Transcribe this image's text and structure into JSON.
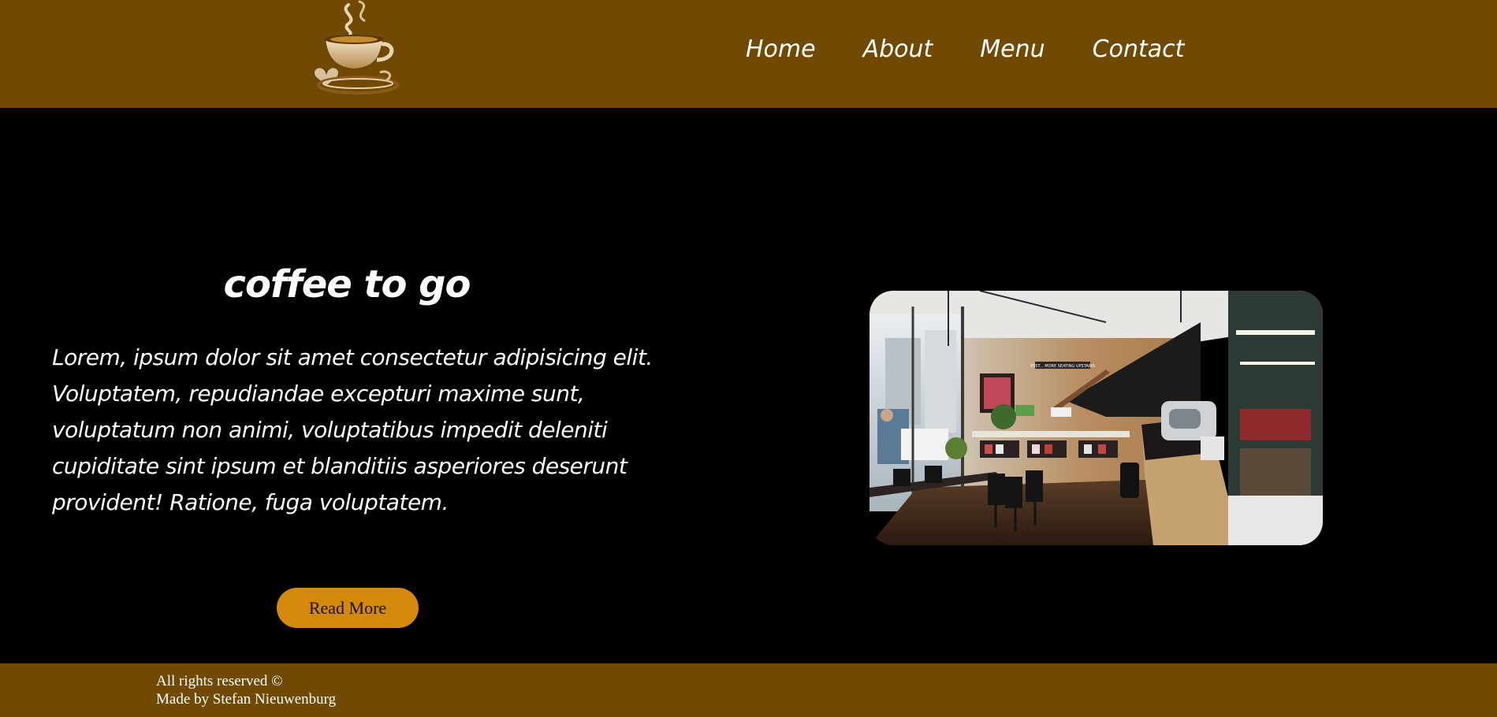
{
  "colors": {
    "header_bg": "#704903",
    "main_bg": "#000000",
    "footer_bg": "#704903",
    "button_bg": "#d4890a",
    "text": "#ffffff"
  },
  "header": {
    "logo_icon": "coffee-cup-icon",
    "nav": [
      {
        "label": "Home"
      },
      {
        "label": "About"
      },
      {
        "label": "Menu"
      },
      {
        "label": "Contact"
      }
    ]
  },
  "hero": {
    "title": "coffee to go",
    "text": "Lorem, ipsum dolor sit amet consectetur adipisicing elit. Voluptatem, repudiandae excepturi maxime sunt, voluptatum non animi, voluptatibus impedit deleniti cupiditate sint ipsum et blanditiis asperiores deserunt provident! Ratione, fuga voluptatem.",
    "button_label": "Read More",
    "photo_sign": "PSST... MORE SEATING UPSTAIRS"
  },
  "footer": {
    "line1": "All rights reserved ©",
    "line2": "Made by Stefan Nieuwenburg"
  }
}
